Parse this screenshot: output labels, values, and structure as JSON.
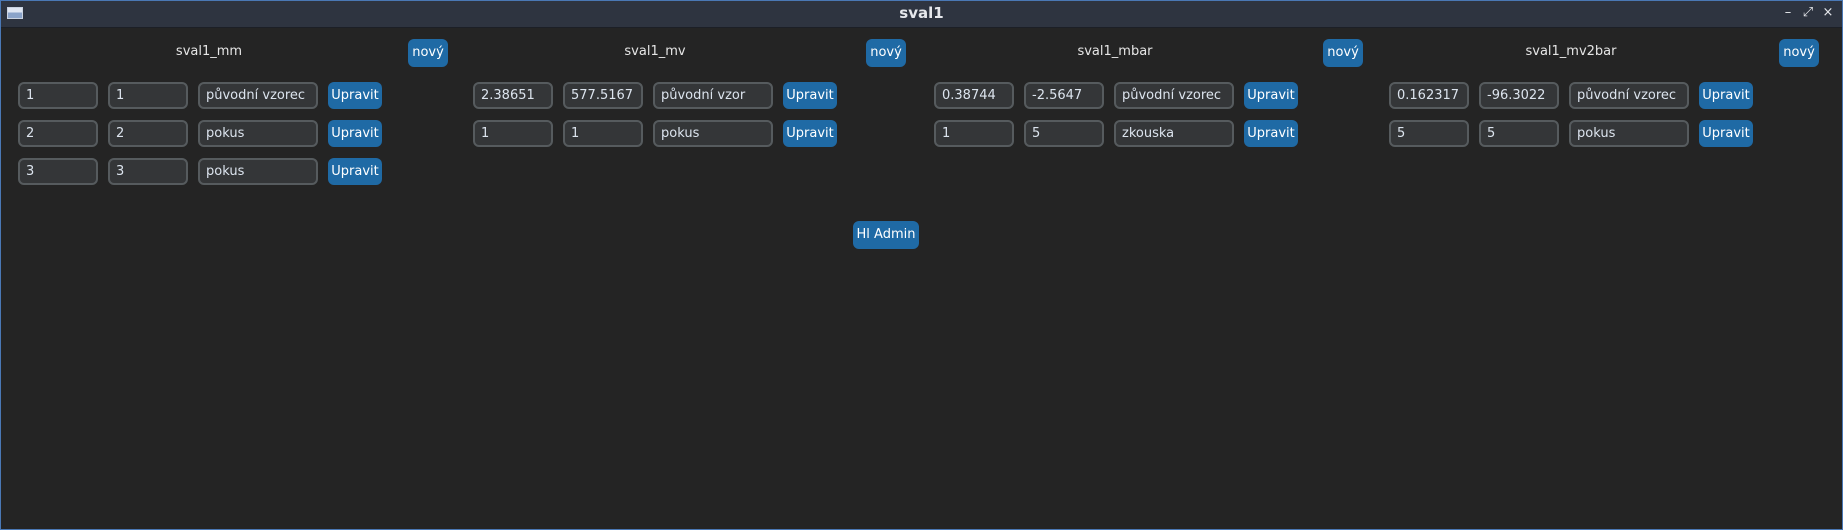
{
  "window": {
    "title": "sval1",
    "controls": [
      "–",
      "⤢",
      "×"
    ]
  },
  "columns": [
    {
      "title": "sval1_mm",
      "new_label": "nový",
      "rows": [
        {
          "a": "1",
          "b": "1",
          "name": "původní vzorec",
          "edit_label": "Upravit"
        },
        {
          "a": "2",
          "b": "2",
          "name": "pokus",
          "edit_label": "Upravit"
        },
        {
          "a": "3",
          "b": "3",
          "name": "pokus",
          "edit_label": "Upravit"
        }
      ]
    },
    {
      "title": "sval1_mv",
      "new_label": "nový",
      "rows": [
        {
          "a": "2.38651",
          "b": "577.5167",
          "name": "původní vzor",
          "edit_label": "Upravit"
        },
        {
          "a": "1",
          "b": "1",
          "name": "pokus",
          "edit_label": "Upravit"
        }
      ]
    },
    {
      "title": "sval1_mbar",
      "new_label": "nový",
      "rows": [
        {
          "a": "0.38744",
          "b": "-2.5647",
          "name": "původní vzorec",
          "edit_label": "Upravit"
        },
        {
          "a": "1",
          "b": "5",
          "name": "zkouska",
          "edit_label": "Upravit"
        }
      ]
    },
    {
      "title": "sval1_mv2bar",
      "new_label": "nový",
      "rows": [
        {
          "a": "0.162317",
          "b": "-96.3022",
          "name": "původní vzorec",
          "edit_label": "Upravit"
        },
        {
          "a": "5",
          "b": "5",
          "name": "pokus",
          "edit_label": "Upravit"
        }
      ]
    }
  ],
  "admin_button": "Hl Admin",
  "colors": {
    "accent": "#1f6aa5",
    "background": "#242424",
    "entry_bg": "#343638",
    "entry_border": "#565b5e",
    "titlebar": "#2e3440"
  }
}
